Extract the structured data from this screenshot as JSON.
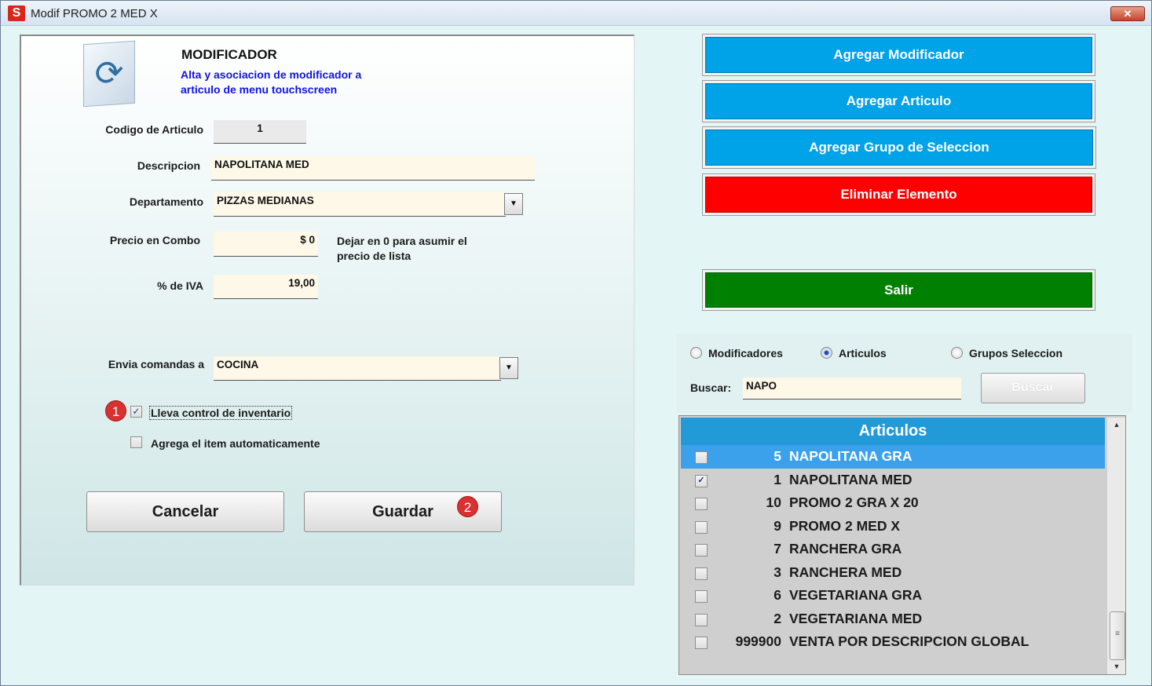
{
  "window": {
    "title": "Modif PROMO 2 MED X",
    "app_icon": "S",
    "close_label": "✕"
  },
  "header": {
    "title": "MODIFICADOR",
    "subtitle_line1": "Alta y asociacion de modificador a",
    "subtitle_line2": "articulo de menu touchscreen",
    "icon": "refresh-arrows-icon"
  },
  "form": {
    "codigo_label": "Codigo de Articulo",
    "codigo_value": "1",
    "descripcion_label": "Descripcion",
    "descripcion_value": "NAPOLITANA MED",
    "departamento_label": "Departamento",
    "departamento_value": "PIZZAS MEDIANAS",
    "precio_label": "Precio en Combo",
    "precio_value": "$ 0",
    "precio_note_line1": "Dejar en 0 para asumir el",
    "precio_note_line2": "precio de lista",
    "iva_label": "% de IVA",
    "iva_value": "19,00",
    "envia_label": "Envia comandas a",
    "envia_value": "COCINA",
    "inventario_label": "Lleva control de inventario",
    "inventario_checked": true,
    "agrega_label": "Agrega el item automaticamente",
    "agrega_checked": false
  },
  "badges": {
    "one": "1",
    "two": "2"
  },
  "buttons": {
    "cancelar": "Cancelar",
    "guardar": "Guardar",
    "agregar_modificador": "Agregar  Modificador",
    "agregar_articulo": "Agregar Articulo",
    "agregar_grupo": "Agregar Grupo de Seleccion",
    "eliminar": "Eliminar Elemento",
    "salir": "Salir",
    "buscar": "Buscar"
  },
  "colors": {
    "blue_btn": "#00a2e8",
    "red_btn": "#ff0000",
    "green_btn": "#008000",
    "list_header": "#229ad8",
    "selected_row": "#3aa1ea"
  },
  "filter": {
    "options": [
      "Modificadores",
      "Articulos",
      "Grupos Seleccion"
    ],
    "selected": "Articulos",
    "search_label": "Buscar:",
    "search_value": "NAPO"
  },
  "list": {
    "header": "Articulos",
    "rows": [
      {
        "code": "5",
        "name": "NAPOLITANA GRA",
        "checked": false,
        "selected": true
      },
      {
        "code": "1",
        "name": "NAPOLITANA MED",
        "checked": true,
        "selected": false
      },
      {
        "code": "10",
        "name": "PROMO 2 GRA X 20",
        "checked": false,
        "selected": false
      },
      {
        "code": "9",
        "name": "PROMO 2 MED X",
        "checked": false,
        "selected": false
      },
      {
        "code": "7",
        "name": "RANCHERA GRA",
        "checked": false,
        "selected": false
      },
      {
        "code": "3",
        "name": "RANCHERA MED",
        "checked": false,
        "selected": false
      },
      {
        "code": "6",
        "name": "VEGETARIANA GRA",
        "checked": false,
        "selected": false
      },
      {
        "code": "2",
        "name": "VEGETARIANA MED",
        "checked": false,
        "selected": false
      },
      {
        "code": "999900",
        "name": "VENTA POR DESCRIPCION GLOBAL",
        "checked": false,
        "selected": false
      }
    ]
  }
}
